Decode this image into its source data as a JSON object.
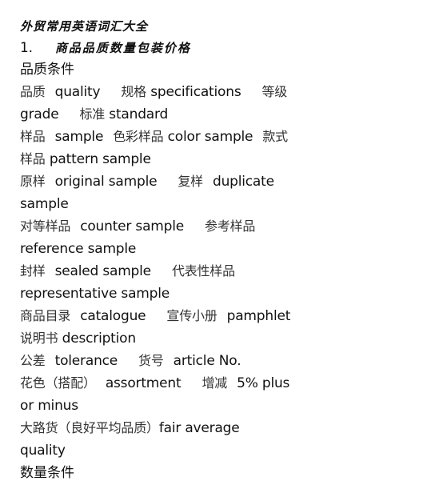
{
  "document": {
    "title": "外贸常用英语词汇大全",
    "section_number": "1.",
    "section_title": "商品品质数量包装价格",
    "subsections": [
      {
        "heading": "品质条件",
        "lines": [
          "品质  quality      规格 specifications     等级",
          "grade      标准 standard",
          "样品  sample   色彩样品 color sample   款式",
          "样品 pattern sample",
          "原样  original sample     复样  duplicate",
          "sample",
          "对等样品  counter sample     参考样品",
          "reference sample",
          "封样  sealed sample     代表性样品",
          "representative sample",
          "商品目录  catalogue     宣传小册  pamphlet",
          "说明书 description",
          "公差  tolerance     货号  article No.",
          "花色（搭配） assortment     增减  5% plus",
          "or minus",
          "大路货（良好平均品质）fair average",
          "quality"
        ]
      },
      {
        "heading": "数量条件",
        "lines": []
      }
    ]
  },
  "terms": [
    {
      "zh": "品质",
      "en": "quality"
    },
    {
      "zh": "规格",
      "en": "specifications"
    },
    {
      "zh": "等级",
      "en": "grade"
    },
    {
      "zh": "标准",
      "en": "standard"
    },
    {
      "zh": "样品",
      "en": "sample"
    },
    {
      "zh": "色彩样品",
      "en": "color sample"
    },
    {
      "zh": "款式样品",
      "en": "pattern sample"
    },
    {
      "zh": "原样",
      "en": "original sample"
    },
    {
      "zh": "复样",
      "en": "duplicate sample"
    },
    {
      "zh": "对等样品",
      "en": "counter sample"
    },
    {
      "zh": "参考样品",
      "en": "reference sample"
    },
    {
      "zh": "封样",
      "en": "sealed sample"
    },
    {
      "zh": "代表性样品",
      "en": "representative sample"
    },
    {
      "zh": "商品目录",
      "en": "catalogue"
    },
    {
      "zh": "宣传小册",
      "en": "pamphlet"
    },
    {
      "zh": "说明书",
      "en": "description"
    },
    {
      "zh": "公差",
      "en": "tolerance"
    },
    {
      "zh": "货号",
      "en": "article No."
    },
    {
      "zh": "花色（搭配）",
      "en": "assortment"
    },
    {
      "zh": "增减",
      "en": "5% plus or minus"
    },
    {
      "zh": "大路货（良好平均品质）",
      "en": "fair average quality"
    }
  ]
}
